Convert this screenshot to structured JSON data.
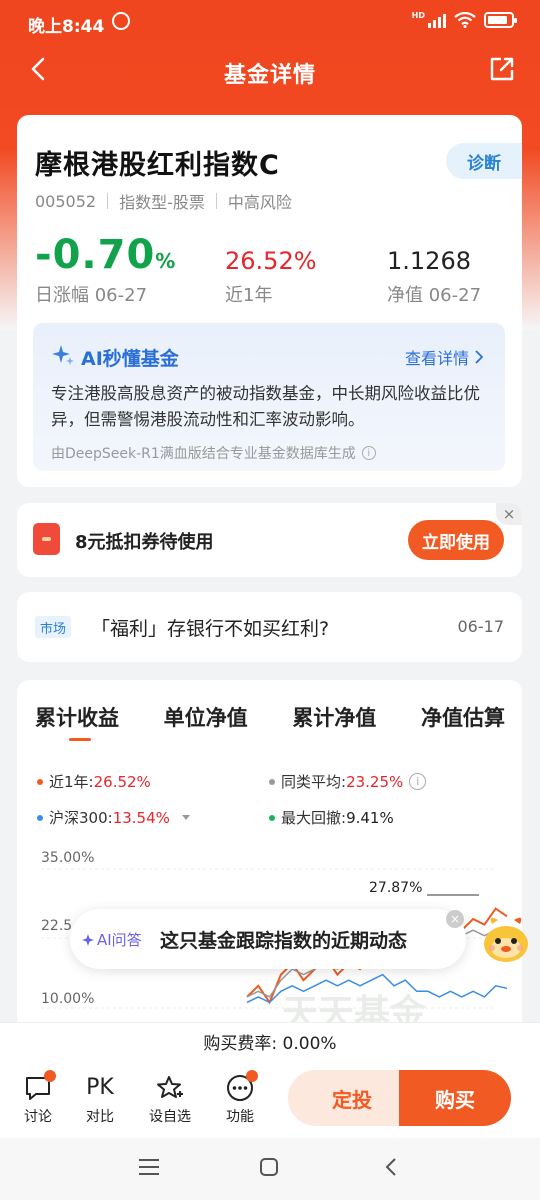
{
  "status_bar": {
    "time": "晚上8:44",
    "network": "HD"
  },
  "nav": {
    "title": "基金详情"
  },
  "fund": {
    "name": "摩根港股红利指数C",
    "diagnose_label": "诊断",
    "code": "005052",
    "type": "指数型-股票",
    "risk": "中高风险",
    "daily_change": "-0.70",
    "daily_change_unit": "%",
    "daily_change_label": "日涨幅 06-27",
    "year_return": "26.52%",
    "year_return_label": "近1年",
    "nav_value": "1.1268",
    "nav_label": "净值 06-27"
  },
  "ai_summary": {
    "title": "AI秒懂基金",
    "more": "查看详情",
    "text": "专注港股高股息资产的被动指数基金，中长期风险收益比优异，但需警惕港股流动性和汇率波动影响。",
    "source": "由DeepSeek-R1满血版结合专业基金数据库生成"
  },
  "coupon": {
    "text": "8元抵扣券待使用",
    "button": "立即使用",
    "close": "×"
  },
  "news": {
    "tag": "市场",
    "title": "「福利」存银行不如买红利?",
    "date": "06-17"
  },
  "chart": {
    "tabs": [
      "累计收益",
      "单位净值",
      "累计净值",
      "净值估算"
    ],
    "legend": {
      "year_label": "近1年:",
      "year_value": "26.52%",
      "peer_label": "同类平均:",
      "peer_value": "23.25%",
      "hs300_label": "沪深300:",
      "hs300_value": "13.54%",
      "drawdown_label": "最大回撤:",
      "drawdown_value": "9.41%"
    },
    "y_ticks": [
      "35.00%",
      "22.5",
      "10.00%"
    ],
    "annotation": "27.87%",
    "watermark": "天天基金",
    "colors": {
      "fund": "#f15a22",
      "peer": "#999999",
      "hs300": "#3a8ee6",
      "drawdown": "#19b35a"
    }
  },
  "chart_data": {
    "type": "line",
    "title": "累计收益",
    "ylim": [
      10,
      35
    ],
    "y_ticks": [
      "35.00%",
      "22.5",
      "10.00%"
    ],
    "series": [
      {
        "name": "近1年",
        "values": [
          12,
          14,
          11,
          16,
          18,
          15,
          17,
          19,
          16,
          18,
          17,
          20,
          21,
          19,
          22,
          20,
          23,
          21,
          22,
          24,
          26,
          25,
          27.87,
          26.5
        ]
      },
      {
        "name": "同类平均",
        "values": [
          12,
          13,
          12,
          15,
          17,
          16,
          17,
          18,
          17,
          18,
          18,
          20,
          21,
          20,
          21,
          20,
          22,
          21,
          22,
          23,
          24,
          23,
          24,
          23.25
        ]
      },
      {
        "name": "沪深300",
        "values": [
          11,
          12,
          11,
          13,
          14,
          13,
          14,
          15,
          14,
          15,
          14,
          15,
          16,
          14,
          15,
          13,
          13,
          12,
          13,
          12,
          13,
          12,
          14,
          13.54
        ]
      }
    ],
    "annotations": [
      "27.87%"
    ]
  },
  "ai_float": {
    "tag": "AI问答",
    "text": "这只基金跟踪指数的近期动态",
    "close": "×"
  },
  "fee": {
    "text": "购买费率: 0.00%"
  },
  "bottom_bar": {
    "items": [
      {
        "label": "讨论",
        "icon": "chat-icon"
      },
      {
        "label": "对比",
        "icon": "pk-icon",
        "glyph": "PK"
      },
      {
        "label": "设自选",
        "icon": "star-plus-icon"
      },
      {
        "label": "功能",
        "icon": "more-icon"
      }
    ],
    "fixed_invest": "定投",
    "buy": "购买"
  }
}
